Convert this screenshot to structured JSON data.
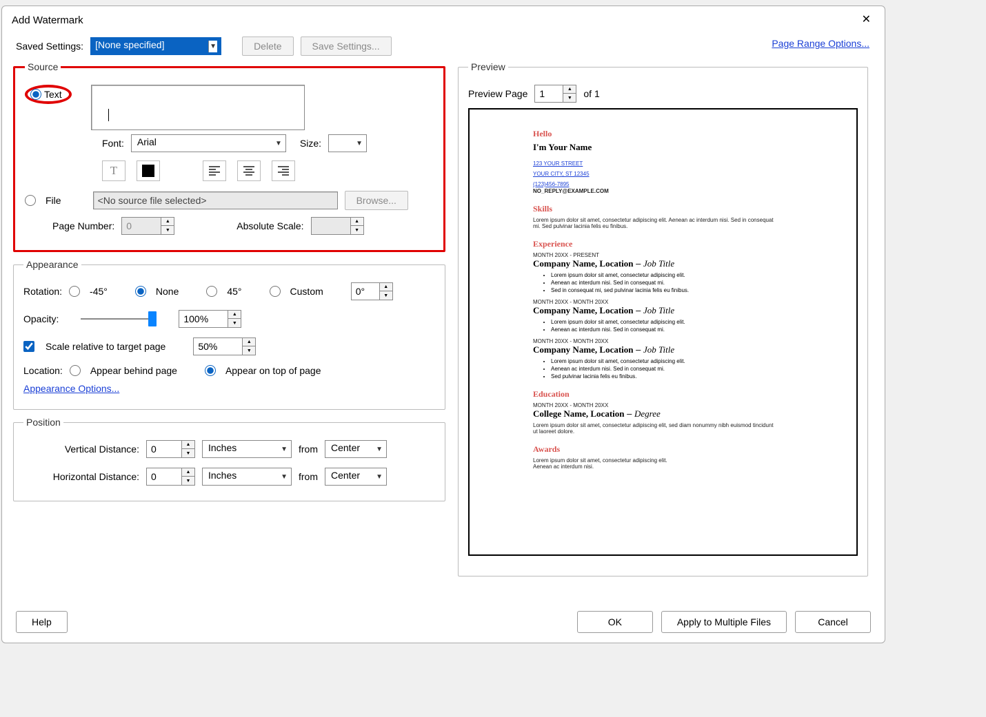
{
  "title": "Add Watermark",
  "savedSettings": {
    "label": "Saved Settings:",
    "value": "[None specified]",
    "delete": "Delete",
    "save": "Save Settings..."
  },
  "pageRangeLink": "Page Range Options...",
  "source": {
    "legend": "Source",
    "textRadio": "Text",
    "fontLabel": "Font:",
    "fontValue": "Arial",
    "sizeLabel": "Size:",
    "sizeValue": "",
    "fileRadio": "File",
    "filePlaceholder": "<No source file selected>",
    "browse": "Browse...",
    "pageNumLabel": "Page Number:",
    "pageNumValue": "0",
    "absScaleLabel": "Absolute Scale:",
    "absScaleValue": ""
  },
  "appearance": {
    "legend": "Appearance",
    "rotationLabel": "Rotation:",
    "rotNeg45": "-45°",
    "rotNone": "None",
    "rot45": "45°",
    "rotCustom": "Custom",
    "rotValue": "0°",
    "opacityLabel": "Opacity:",
    "opacityValue": "100%",
    "scaleChk": "Scale relative to target page",
    "scaleValue": "50%",
    "locationLabel": "Location:",
    "locBehind": "Appear behind page",
    "locTop": "Appear on top of page",
    "appearanceLink": "Appearance Options..."
  },
  "position": {
    "legend": "Position",
    "vLabel": "Vertical Distance:",
    "vValue": "0",
    "vUnit": "Inches",
    "fromLabel": "from",
    "vFrom": "Center",
    "hLabel": "Horizontal Distance:",
    "hValue": "0",
    "hUnit": "Inches",
    "hFrom": "Center"
  },
  "preview": {
    "legend": "Preview",
    "pageLabel": "Preview Page",
    "pageValue": "1",
    "totalLabel": "of 1",
    "doc": {
      "hello": "Hello",
      "name": "I'm Your Name",
      "addr1": "123 YOUR STREET",
      "addr2": "YOUR CITY, ST 12345",
      "phone": "(123)456-7895",
      "email": "NO_REPLY@EXAMPLE.COM",
      "skills": "Skills",
      "skillsBody": "Lorem ipsum dolor sit amet, consectetur adipiscing elit. Aenean ac interdum nisi. Sed in consequat mi. Sed pulvinar lacinia felis eu finibus.",
      "exp": "Experience",
      "e1date": "MONTH 20XX - PRESENT",
      "e1title": "Company Name, Location",
      "e1dash": " – ",
      "e1role": "Job Title",
      "b1": "Lorem ipsum dolor sit amet, consectetur adipiscing elit.",
      "b2": "Aenean ac interdum nisi. Sed in consequat mi.",
      "b3": "Sed in consequat mi, sed pulvinar lacinia felis eu finibus.",
      "e2date": "MONTH 20XX - MONTH 20XX",
      "e2title": "Company Name, Location",
      "e2role": "Job Title",
      "b4": "Lorem ipsum dolor sit amet, consectetur adipiscing elit.",
      "b5": "Aenean ac interdum nisi. Sed in consequat mi.",
      "e3date": "MONTH 20XX - MONTH 20XX",
      "e3title": "Company Name, Location",
      "e3role": "Job Title",
      "b6": "Lorem ipsum dolor sit amet, consectetur adipiscing elit.",
      "b7": "Aenean ac interdum nisi. Sed in consequat mi.",
      "b8": "Sed pulvinar lacinia felis eu finibus.",
      "edu": "Education",
      "eduDate": "MONTH 20XX - MONTH 20XX",
      "eduTitle": "College Name, Location",
      "eduRole": "Degree",
      "eduBody": "Lorem ipsum dolor sit amet, consectetur adipiscing elit, sed diam nonummy nibh euismod tincidunt ut laoreet dolore.",
      "awards": "Awards",
      "aw1": "Lorem ipsum dolor sit amet, consectetur adipiscing elit.",
      "aw2": "Aenean ac interdum nisi."
    }
  },
  "footer": {
    "help": "Help",
    "ok": "OK",
    "apply": "Apply to Multiple Files",
    "cancel": "Cancel"
  }
}
